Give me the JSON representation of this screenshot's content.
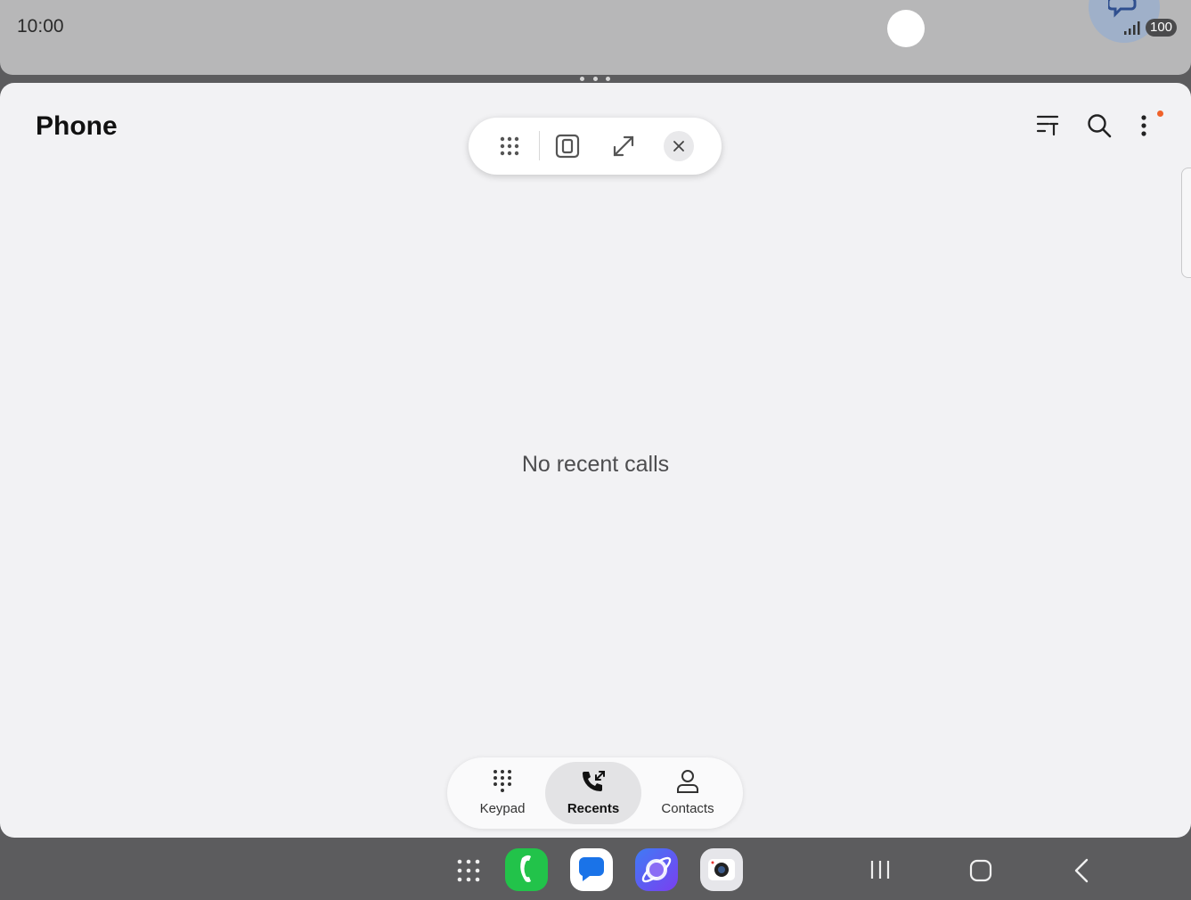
{
  "status_bar": {
    "time": "10:00",
    "battery": "100"
  },
  "app": {
    "title": "Phone"
  },
  "window_controls": {
    "app_drawer_icon": "grid-dots-icon",
    "split_view_icon": "split-screen-icon",
    "maximize_icon": "expand-diagonal-icon",
    "close_icon": "close-icon"
  },
  "toolbar": {
    "filter_icon": "filter-sort-icon",
    "search_icon": "search-icon",
    "more_icon": "more-vertical-icon"
  },
  "main": {
    "empty_message": "No recent calls"
  },
  "tabs": [
    {
      "label": "Keypad",
      "icon": "keypad-icon",
      "active": false
    },
    {
      "label": "Recents",
      "icon": "recent-calls-icon",
      "active": true
    },
    {
      "label": "Contacts",
      "icon": "contact-person-icon",
      "active": false
    }
  ],
  "dock": {
    "apps": [
      {
        "name": "Apps",
        "icon": "app-grid-icon"
      },
      {
        "name": "Phone",
        "icon": "phone-app-icon",
        "color": "#22c34a"
      },
      {
        "name": "Messages",
        "icon": "messages-app-icon",
        "color": "#1a73e8"
      },
      {
        "name": "Internet",
        "icon": "internet-app-icon",
        "color": "#6a4cf0"
      },
      {
        "name": "Camera",
        "icon": "camera-app-icon",
        "color": "#e6e6ea"
      }
    ]
  },
  "colors": {
    "accent_notification": "#f0622a",
    "window_bg": "#f2f2f4",
    "nav_bg": "#5c5c5e"
  }
}
